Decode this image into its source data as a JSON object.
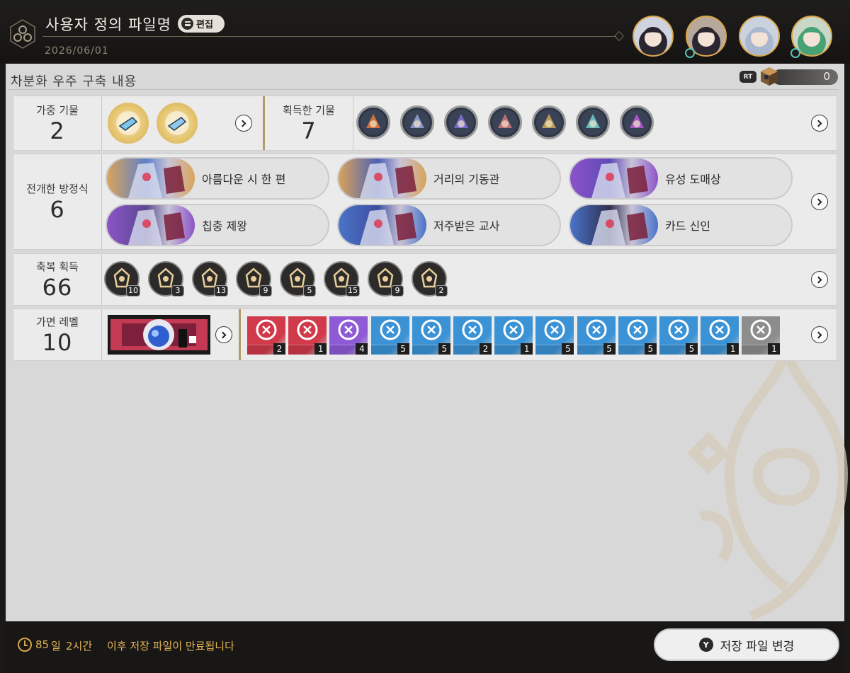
{
  "header": {
    "file_name": "사용자 정의 파일명",
    "edit_label": "편집",
    "date": "2026/06/01",
    "avatars": [
      {
        "name": "character-avatar-1",
        "bg": "#cfd3e0",
        "hair": "#2a2630",
        "has_badge": false
      },
      {
        "name": "character-avatar-2",
        "bg": "#b7a89c",
        "hair": "#2b2530",
        "has_badge": true
      },
      {
        "name": "character-avatar-3",
        "bg": "#cbd2df",
        "hair": "#a9b8cf",
        "has_badge": false
      },
      {
        "name": "character-avatar-4",
        "bg": "#c9d7c9",
        "hair": "#47a275",
        "has_badge": true
      }
    ]
  },
  "main": {
    "section_title": "차분화 우주 구축 내용",
    "rt_badge": "RT",
    "rt_value": "0"
  },
  "weighted_curios": {
    "label": "가중 기물",
    "count": "2",
    "items": [
      {
        "name": "blaster-curio-icon",
        "color": "#7bc4ea"
      },
      {
        "name": "swirl-curio-icon",
        "color": "#8fc8e8"
      }
    ]
  },
  "obtained_curios": {
    "label": "획득한 기물",
    "count": "7",
    "items": [
      {
        "name": "flame-curio-icon",
        "color": "#e2773a"
      },
      {
        "name": "book-curio-icon",
        "color": "#8f9fcf"
      },
      {
        "name": "card-curio-icon",
        "color": "#7d6fd6"
      },
      {
        "name": "bracelet-curio-icon",
        "color": "#c9747b"
      },
      {
        "name": "trophy-curio-icon",
        "color": "#c6a45a"
      },
      {
        "name": "crystal-curio-icon",
        "color": "#6ec6c8"
      },
      {
        "name": "orb-curio-icon",
        "color": "#b35ad1"
      }
    ]
  },
  "equations": {
    "label": "전개한 방정식",
    "count": "6",
    "items": [
      {
        "name": "아름다운 시 한 편",
        "frame": "#d9a35a",
        "tone": "#5d80c9"
      },
      {
        "name": "거리의 기동관",
        "frame": "#d9a35a",
        "tone": "#4c5fb6"
      },
      {
        "name": "유성 도매상",
        "frame": "#8c53c9",
        "tone": "#5e4ab6"
      },
      {
        "name": "칩충 제왕",
        "frame": "#8c53c9",
        "tone": "#5a4a8f"
      },
      {
        "name": "저주받은 교사",
        "frame": "#4a73c9",
        "tone": "#3f4f9f"
      },
      {
        "name": "카드 신인",
        "frame": "#4a73c9",
        "tone": "#2f2f4f"
      }
    ]
  },
  "blessings": {
    "label": "축복 획득",
    "count": "66",
    "items": [
      {
        "name": "preservation-blessing-icon",
        "count": "10"
      },
      {
        "name": "remembrance-blessing-icon",
        "count": "3"
      },
      {
        "name": "nihility-blessing-icon",
        "count": "13"
      },
      {
        "name": "abundance-blessing-icon",
        "count": "9"
      },
      {
        "name": "hunt-blessing-icon",
        "count": "5"
      },
      {
        "name": "destruction-blessing-icon",
        "count": "15"
      },
      {
        "name": "elation-blessing-icon",
        "count": "9"
      },
      {
        "name": "propagation-blessing-icon",
        "count": "2"
      }
    ]
  },
  "mask": {
    "label": "가면 레벨",
    "count": "10",
    "cards": [
      {
        "name": "crossed-swords-card-icon",
        "color": "#d03a4a",
        "count": "2"
      },
      {
        "name": "sword-card-icon",
        "color": "#d03a4a",
        "count": "1"
      },
      {
        "name": "question-card-icon",
        "color": "#8e5ad6",
        "count": "4"
      },
      {
        "name": "question-card-icon",
        "color": "#3b93d6",
        "count": "5"
      },
      {
        "name": "question-card-icon",
        "color": "#3b93d6",
        "count": "5"
      },
      {
        "name": "dice-card-icon",
        "color": "#3b93d6",
        "count": "2"
      },
      {
        "name": "scales-card-icon",
        "color": "#3b93d6",
        "count": "1"
      },
      {
        "name": "chest-card-icon",
        "color": "#3b93d6",
        "count": "5"
      },
      {
        "name": "chest-card-icon",
        "color": "#3b93d6",
        "count": "5"
      },
      {
        "name": "chest-card-icon",
        "color": "#3b93d6",
        "count": "5"
      },
      {
        "name": "chest-card-icon",
        "color": "#3b93d6",
        "count": "5"
      },
      {
        "name": "creature-card-icon",
        "color": "#3b93d6",
        "count": "1"
      },
      {
        "name": "blank-card-icon",
        "color": "#8d8d8d",
        "count": "1"
      }
    ]
  },
  "footer": {
    "days": "85",
    "days_unit": "일",
    "hours": "2시간",
    "expiry_text": "이후 저장 파일이 만료됩니다",
    "button_key": "Y",
    "button_label": "저장 파일 변경"
  },
  "colors": {
    "accent_gold": "#d9a64a",
    "panel_bg": "#d8d8d8",
    "row_bg": "#ebebeb",
    "footer_text": "#e5b456"
  }
}
